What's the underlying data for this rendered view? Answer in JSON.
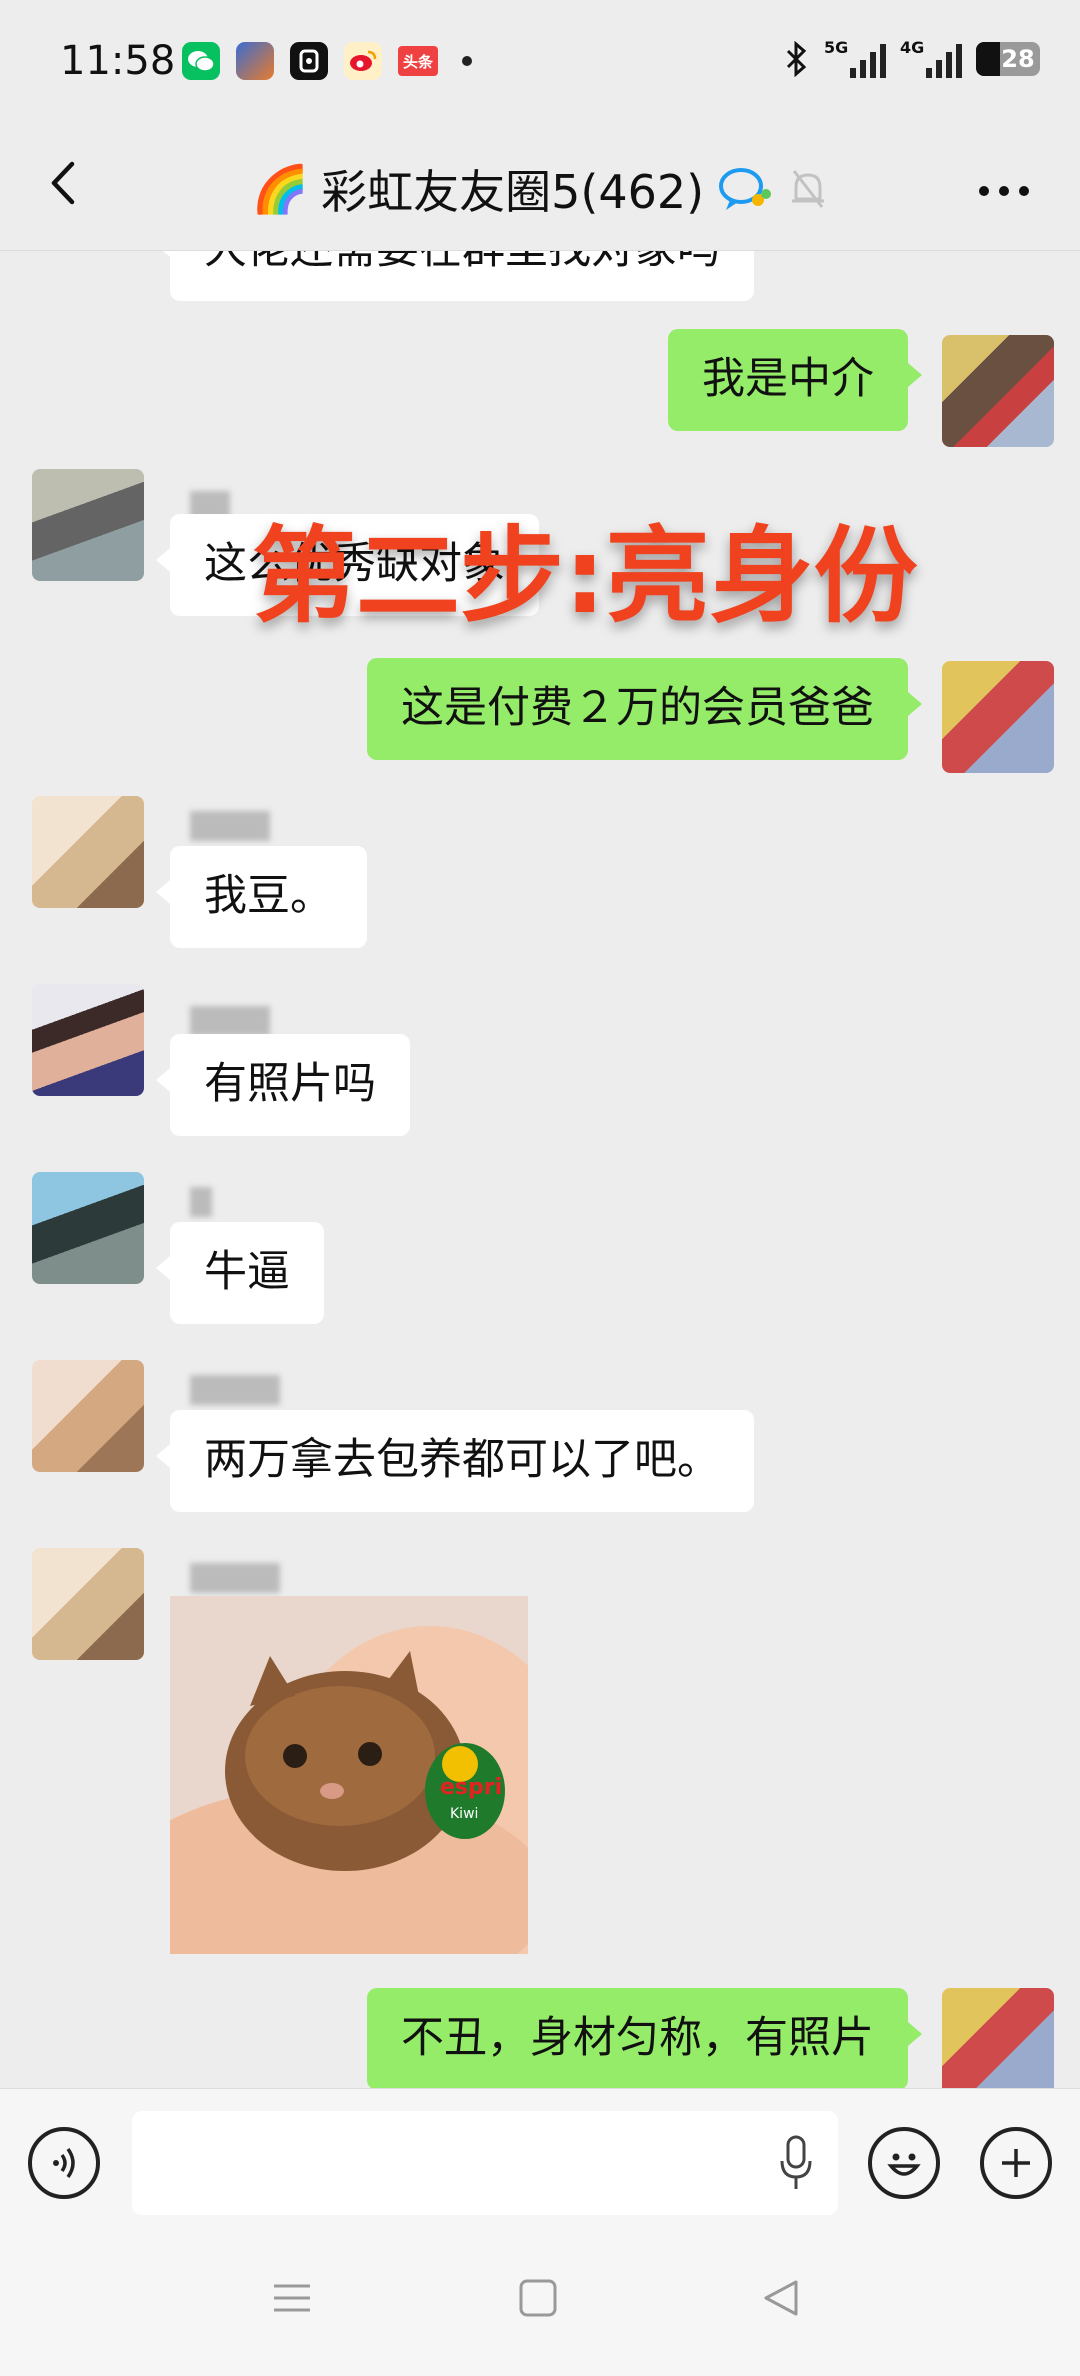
{
  "status_bar": {
    "time": "11:58",
    "app_icons": [
      "wechat-icon",
      "game-icon",
      "app-icon",
      "weibo-icon",
      "toutiao-icon"
    ],
    "toutiao_label": "头条",
    "signal1_label": "5G",
    "signal2_label": "4G",
    "battery": "28"
  },
  "nav": {
    "title": "彩虹友友圈5(462)",
    "title_emoji": "🌈"
  },
  "overlay": {
    "caption": "第二步:亮身份"
  },
  "messages": [
    {
      "side": "in",
      "text": "大佬还需要在群里找对象吗"
    },
    {
      "side": "out",
      "text": "我是中介"
    },
    {
      "side": "in",
      "text": "这么优秀缺对象"
    },
    {
      "side": "out",
      "text": "这是付费２万的会员爸爸"
    },
    {
      "side": "in",
      "text": "我豆。"
    },
    {
      "side": "in",
      "text": "有照片吗"
    },
    {
      "side": "in",
      "text": "牛逼"
    },
    {
      "side": "in",
      "text": "两万拿去包养都可以了吧。"
    },
    {
      "side": "in",
      "image": "kitten-photo",
      "image_text": "espri",
      "image_text2": "Kiwi"
    },
    {
      "side": "out",
      "text": "不丑，身材匀称，有照片"
    }
  ],
  "colors": {
    "background": "#ededed",
    "out_bubble": "#95ec69",
    "in_bubble": "#ffffff",
    "overlay_text": "#f0421e"
  }
}
